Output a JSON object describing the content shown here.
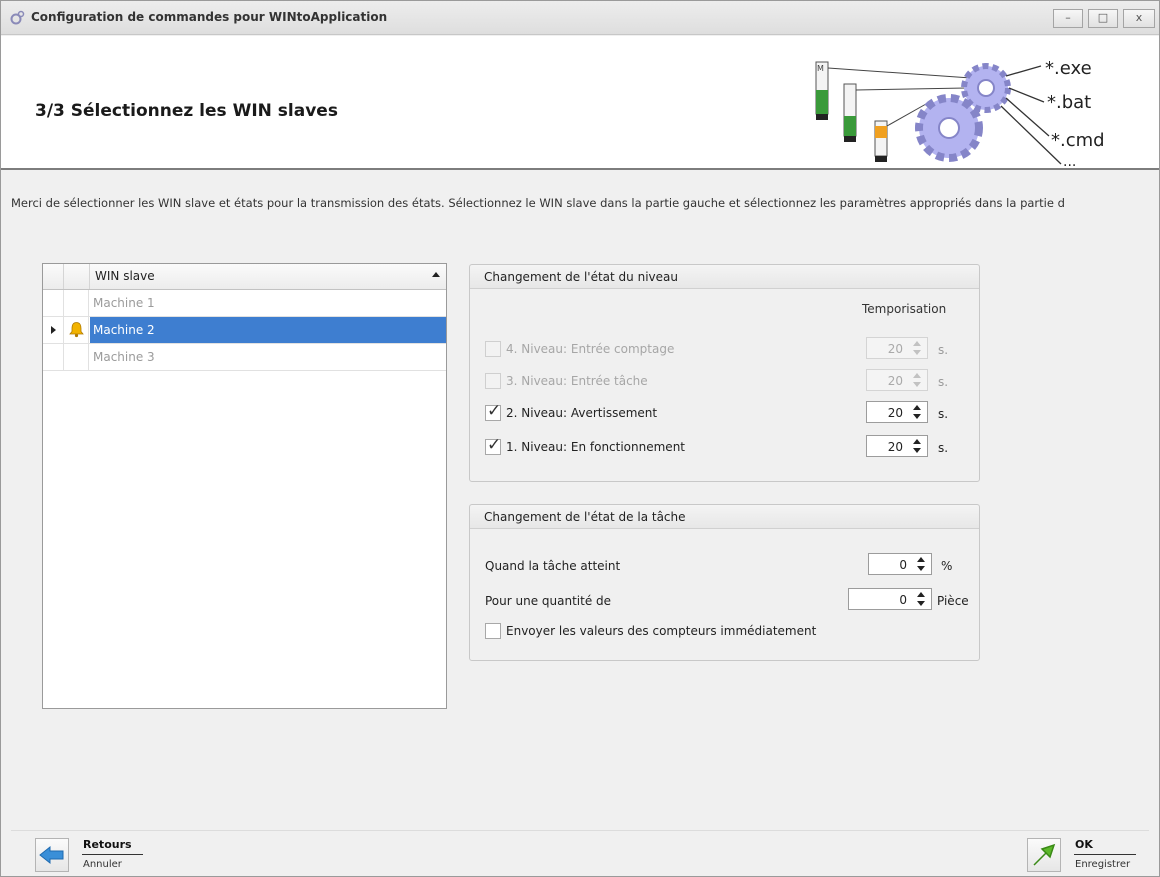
{
  "window": {
    "title": "Configuration de commandes pour WINtoApplication",
    "controls": {
      "minimize": "–",
      "maximize": "□",
      "close": "x"
    }
  },
  "header": {
    "step_title": "3/3 Sélectionnez les WIN slaves",
    "banner": {
      "ext1": "*.exe",
      "ext2": "*.bat",
      "ext3": "*.cmd",
      "ext4": "...",
      "tower_badge": "M"
    }
  },
  "intro_text": "Merci de sélectionner les WIN slave et états pour la transmission des états. Sélectionnez  le WIN slave dans la partie gauche et sélectionnez les paramètres appropriés dans la partie d",
  "grid": {
    "column_header": "WIN slave",
    "rows": [
      {
        "label": "Machine 1",
        "selected": false
      },
      {
        "label": "Machine 2",
        "selected": true,
        "icon": "bell-icon"
      },
      {
        "label": "Machine 3",
        "selected": false
      }
    ]
  },
  "level_group": {
    "title": "Changement de l'état du niveau",
    "tempo_header": "Temporisation",
    "options": [
      {
        "label": "4. Niveau: Entrée comptage",
        "checked": false,
        "enabled": false,
        "value": "20",
        "unit": "s."
      },
      {
        "label": "3. Niveau: Entrée tâche",
        "checked": false,
        "enabled": false,
        "value": "20",
        "unit": "s."
      },
      {
        "label": "2. Niveau: Avertissement",
        "checked": true,
        "enabled": true,
        "value": "20",
        "unit": "s."
      },
      {
        "label": "1. Niveau: En fonctionnement",
        "checked": true,
        "enabled": true,
        "value": "20",
        "unit": "s."
      }
    ],
    "check_glyph": "✓"
  },
  "task_group": {
    "title": "Changement de l'état de la tâche",
    "reach_label": "Quand la tâche atteint",
    "reach_value": "0",
    "reach_unit": "%",
    "qty_label": "Pour une quantité de",
    "qty_value": "0",
    "qty_unit": "Pièce",
    "send_label": "Envoyer les valeurs des compteurs immédiatement",
    "send_checked": false
  },
  "footer": {
    "back_label": "Retours",
    "back_sub": "Annuler",
    "ok_label": "OK",
    "ok_sub": "Enregistrer"
  },
  "colors": {
    "selection": "#3e7ed0",
    "gear": "#b3b3f0",
    "back_arrow": "#3a8fd8",
    "ok_arrow": "#5cb82a"
  }
}
